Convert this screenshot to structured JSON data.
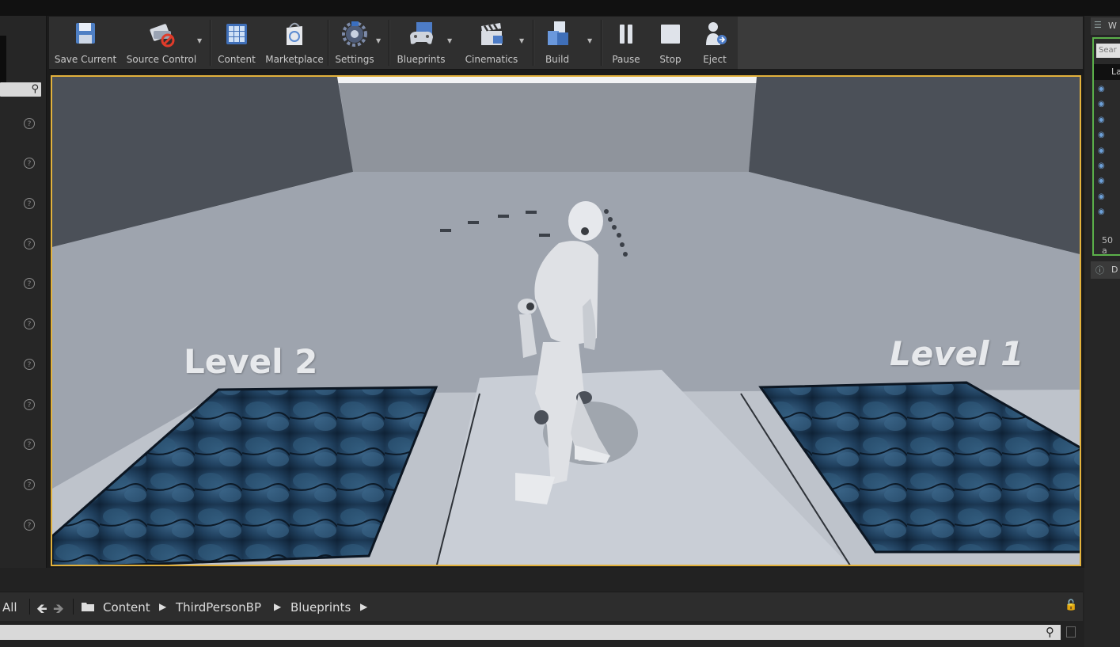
{
  "toolbar": {
    "buttons": [
      {
        "label": "Save Current",
        "icon": "floppy-disk-icon"
      },
      {
        "label": "Source Control",
        "icon": "source-control-icon"
      },
      {
        "label": "Content",
        "icon": "content-grid-icon"
      },
      {
        "label": "Marketplace",
        "icon": "marketplace-bag-icon"
      },
      {
        "label": "Settings",
        "icon": "settings-gear-icon"
      },
      {
        "label": "Blueprints",
        "icon": "blueprints-gamepad-icon"
      },
      {
        "label": "Cinematics",
        "icon": "clapperboard-icon"
      },
      {
        "label": "Build",
        "icon": "build-cubes-icon"
      },
      {
        "label": "Pause",
        "icon": "pause-icon"
      },
      {
        "label": "Stop",
        "icon": "stop-icon"
      },
      {
        "label": "Eject",
        "icon": "eject-person-icon"
      }
    ]
  },
  "viewport": {
    "label_left": "Level 2",
    "label_right": "Level 1",
    "accent_color": "#e3b23c"
  },
  "outliner": {
    "tab_label": "W",
    "search_placeholder": "Sear",
    "header_label": "La",
    "count_label": "50 a",
    "details_tab_label": "D"
  },
  "content_browser": {
    "filter_label": "All",
    "path": [
      "Content",
      "ThirdPersonBP",
      "Blueprints"
    ]
  }
}
